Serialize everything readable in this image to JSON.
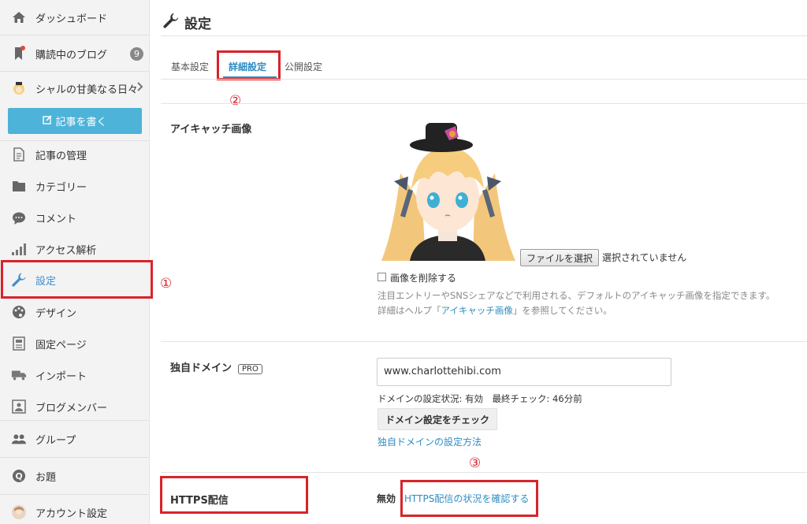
{
  "sidebar": {
    "items": [
      {
        "label": "ダッシュボード",
        "icon": "home-icon"
      },
      {
        "label": "購読中のブログ",
        "icon": "bookmark-icon",
        "badge": "9"
      },
      {
        "label": "シャルの甘美なる日々",
        "icon": "blog-avatar-icon"
      },
      {
        "label": "記事の管理",
        "icon": "document-icon"
      },
      {
        "label": "カテゴリー",
        "icon": "folder-icon"
      },
      {
        "label": "コメント",
        "icon": "comment-icon"
      },
      {
        "label": "アクセス解析",
        "icon": "bar-chart-icon"
      },
      {
        "label": "設定",
        "icon": "wrench-icon"
      },
      {
        "label": "デザイン",
        "icon": "palette-icon"
      },
      {
        "label": "固定ページ",
        "icon": "page-icon"
      },
      {
        "label": "インポート",
        "icon": "truck-icon"
      },
      {
        "label": "ブログメンバー",
        "icon": "member-icon"
      },
      {
        "label": "グループ",
        "icon": "group-icon"
      },
      {
        "label": "お題",
        "icon": "question-icon"
      },
      {
        "label": "アカウント設定",
        "icon": "account-icon"
      }
    ],
    "write_button": "記事を書く"
  },
  "header": {
    "title": "設定"
  },
  "tabs": [
    {
      "label": "基本設定"
    },
    {
      "label": "詳細設定"
    },
    {
      "label": "公開設定"
    }
  ],
  "markers": {
    "one": "①",
    "two": "②",
    "three": "③"
  },
  "eyecatch": {
    "label": "アイキャッチ画像",
    "file_button": "ファイルを選択",
    "file_status": "選択されていません",
    "delete_label": "画像を削除する",
    "help_line1": "注目エントリーやSNSシェアなどで利用される、デフォルトのアイキャッチ画像を指定できます。",
    "help_line2_pre": "詳細はヘルプ「",
    "help_line2_link": "アイキャッチ画像",
    "help_line2_post": "」を参照してください。"
  },
  "domain": {
    "label": "独自ドメイン",
    "pro": "PRO",
    "value": "www.charlottehibi.com",
    "status": "ドメインの設定状況: 有効　最終チェック: 46分前",
    "check_button": "ドメイン設定をチェック",
    "howto_link": "独自ドメインの設定方法"
  },
  "https": {
    "label": "HTTPS配信",
    "state": "無効",
    "link": "HTTPS配信の状況を確認する"
  },
  "colors": {
    "accent": "#2f8dc3",
    "highlight": "#d8232a",
    "write_button": "#4db3d8"
  }
}
